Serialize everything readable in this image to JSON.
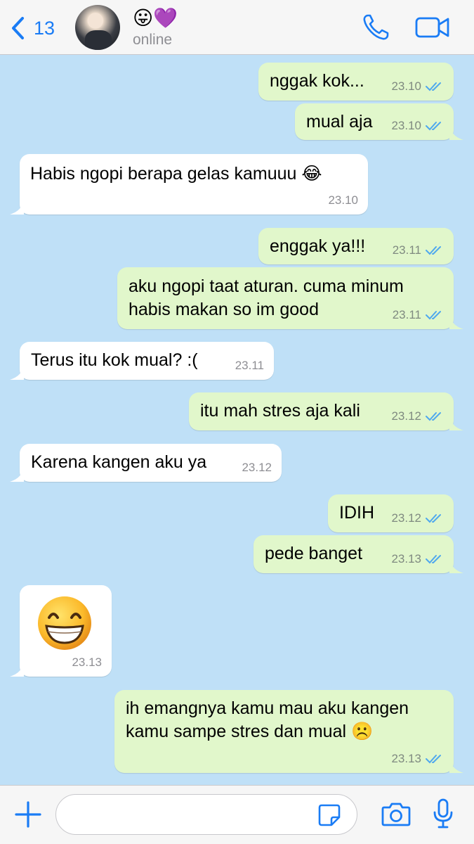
{
  "header": {
    "back_count": "13",
    "contact_name_emoji": "😛💜",
    "status": "online",
    "icons": {
      "back": "chevron-left-icon",
      "call": "phone-icon",
      "video": "video-camera-icon"
    }
  },
  "messages": [
    {
      "direction": "out",
      "text": "nggak kok...",
      "time": "23.10",
      "read": true
    },
    {
      "direction": "out",
      "text": "mual aja",
      "time": "23.10",
      "read": true
    },
    {
      "direction": "in",
      "text": "Habis ngopi berapa gelas kamuuu 😂",
      "time": "23.10"
    },
    {
      "direction": "out",
      "text": "enggak ya!!!",
      "time": "23.11",
      "read": true
    },
    {
      "direction": "out",
      "lines": [
        "aku ngopi taat aturan. cuma minum",
        "habis makan so im good"
      ],
      "time": "23.11",
      "read": true
    },
    {
      "direction": "in",
      "text": "Terus itu kok mual? :(",
      "time": "23.11"
    },
    {
      "direction": "out",
      "text": "itu mah stres aja kali",
      "time": "23.12",
      "read": true
    },
    {
      "direction": "in",
      "text": "Karena kangen aku ya",
      "time": "23.12"
    },
    {
      "direction": "out",
      "text": "IDIH",
      "time": "23.12",
      "read": true
    },
    {
      "direction": "out",
      "text": "pede banget",
      "time": "23.13",
      "read": true
    },
    {
      "direction": "in",
      "sticker": "grinning-emoji-sticker",
      "time": "23.13"
    },
    {
      "direction": "out",
      "lines": [
        "ih emangnya kamu mau aku kangen",
        "kamu sampe stres dan mual ☹️"
      ],
      "time": "23.13",
      "read": true
    }
  ],
  "composer": {
    "input_value": "",
    "icons": {
      "attach": "plus-icon",
      "sticker": "sticker-icon",
      "camera": "camera-icon",
      "mic": "microphone-icon"
    }
  },
  "colors": {
    "chat_background": "#bfe0f7",
    "outgoing_bubble": "#e1f7cb",
    "incoming_bubble": "#ffffff",
    "accent": "#1a7cf5",
    "read_ticks": "#4fa8ee"
  }
}
